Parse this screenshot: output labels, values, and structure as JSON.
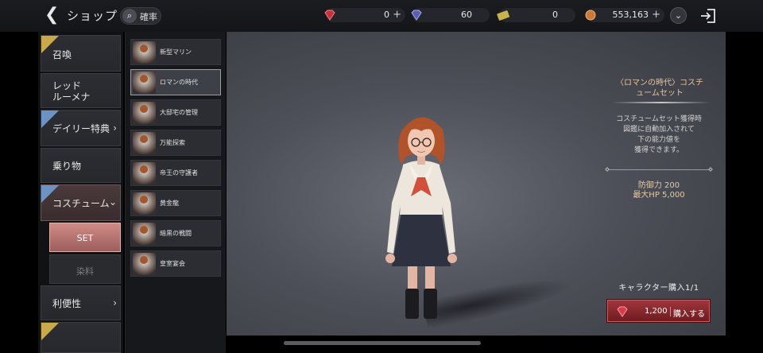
{
  "header": {
    "title": "ショップ",
    "rate_label": "確率",
    "currencies": [
      {
        "name": "ruby",
        "value": "0",
        "color": "#c2323e",
        "has_plus": true
      },
      {
        "name": "crystal",
        "value": "60",
        "color": "#5a5fb0",
        "has_plus": false
      },
      {
        "name": "ticket",
        "value": "0",
        "color": "#c8b44a",
        "has_plus": false
      },
      {
        "name": "coin",
        "value": "553,163",
        "color": "#c87a3a",
        "has_plus": true
      }
    ],
    "plus": "+",
    "dropdown": "⌄"
  },
  "sidebar": {
    "summon": "召喚",
    "red_lumena_1": "レッド",
    "red_lumena_2": "ルーメナ",
    "daily": "デイリー特典",
    "mount": "乗り物",
    "costume": "コスチューム",
    "set": "SET",
    "dye": "染料",
    "convenience": "利便性",
    "chevron": "›"
  },
  "costume_list": [
    "新型マリン",
    "ロマンの時代",
    "大邸宅の管理",
    "万能探索",
    "帝王の守護者",
    "黄金龍",
    "暗黒の戦闘",
    "皇室宴会"
  ],
  "selected_index": 1,
  "detail": {
    "title_1": "〈ロマンの時代〉コスチ",
    "title_2": "ュームセット",
    "desc_1": "コスチュームセット獲得時",
    "desc_2": "図鑑に自動加入されて",
    "desc_3": "下の能力値を",
    "desc_4": "獲得できます。",
    "stat_def": "防御力 200",
    "stat_hp": "最大HP 5,000",
    "buy_count": "キャラクター購入1/1",
    "price": "1,200",
    "buy_label": "購入する"
  }
}
